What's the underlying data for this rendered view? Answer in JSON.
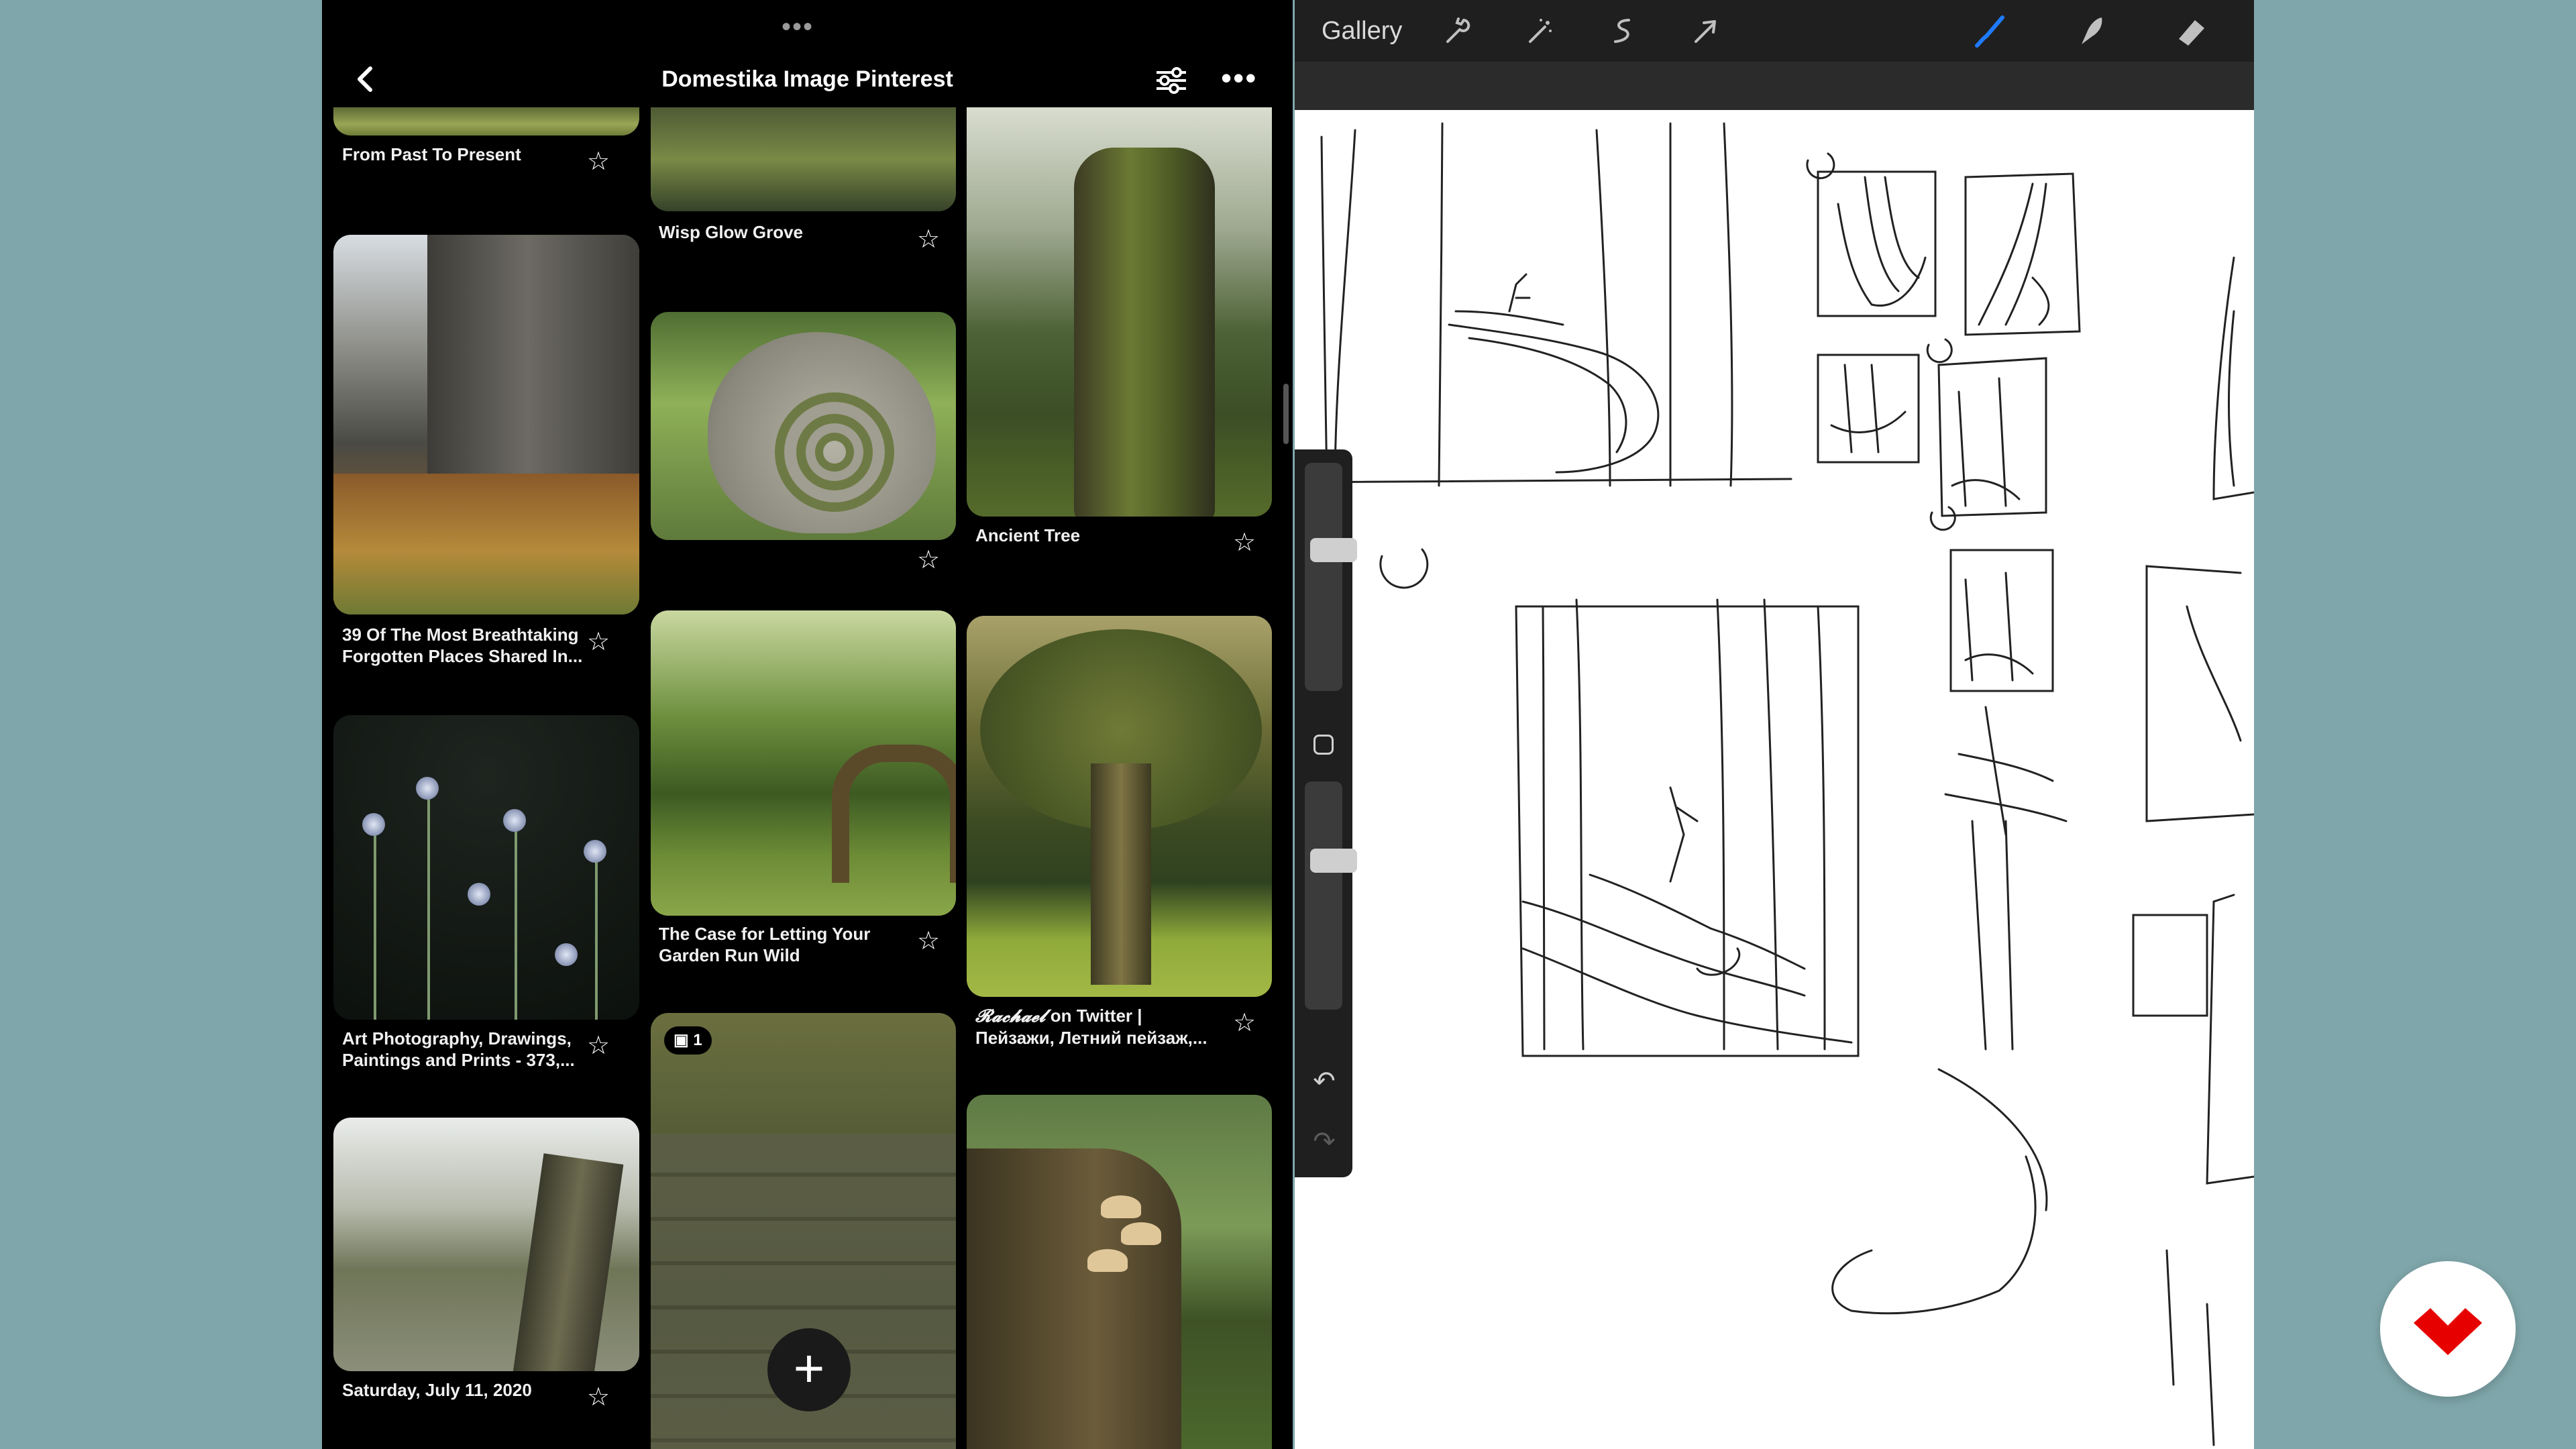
{
  "pinterest": {
    "title": "Domestika Image Pinterest",
    "grabber": "•••",
    "more": "•••",
    "back_icon": "chevron-left-icon",
    "filter_icon": "sliders-icon",
    "pins": {
      "from_past": "From Past To Present",
      "wisp": "Wisp Glow Grove",
      "breathtaking": "39 Of The Most Breathtaking Forgotten Places Shared In...",
      "ancient_tree": "Ancient Tree",
      "garden": "The Case for Letting Your Garden Run Wild",
      "art_photo": "Art Photography, Drawings, Paintings and Prints - 373,...",
      "rachael_name": "𝓡𝓪𝓬𝓱𝓪𝓮𝓵",
      "rachael_rest": " on Twitter | Пейзажи, Летний пейзаж,...",
      "saturday": "Saturday, July 11, 2020"
    },
    "badge_count": "1",
    "add_label": "+"
  },
  "procreate": {
    "gallery": "Gallery",
    "tools": [
      "wrench-icon",
      "magic-wand-icon",
      "selection-icon",
      "transform-icon",
      "brush-icon",
      "smudge-icon",
      "eraser-icon",
      "layers-icon"
    ],
    "accent": "#1e7bff"
  },
  "brand": {
    "color": "#e60000"
  }
}
